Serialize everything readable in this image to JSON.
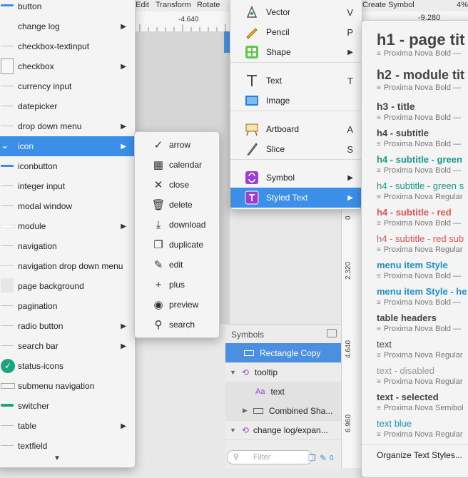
{
  "toolbar": {
    "edit": "Edit",
    "transform": "Transform",
    "rotate": "Rotate",
    "create_symbol": "Create Symbol",
    "zoom": "4%",
    "coord_x": "-4.640",
    "coord_right": "-9.280"
  },
  "ruler": {
    "marks": [
      "0",
      "2.320",
      "4.640",
      "6.960"
    ]
  },
  "menu1": {
    "items": [
      {
        "label": "button",
        "has_sub": false
      },
      {
        "label": "change log",
        "has_sub": true
      },
      {
        "label": "checkbox-textinput",
        "has_sub": false
      },
      {
        "label": "checkbox",
        "has_sub": true
      },
      {
        "label": "currency input",
        "has_sub": false
      },
      {
        "label": "datepicker",
        "has_sub": false
      },
      {
        "label": "drop down menu",
        "has_sub": true
      },
      {
        "label": "icon",
        "has_sub": true,
        "selected": true
      },
      {
        "label": "iconbutton",
        "has_sub": false
      },
      {
        "label": "integer input",
        "has_sub": false
      },
      {
        "label": "modal window",
        "has_sub": false
      },
      {
        "label": "module",
        "has_sub": true
      },
      {
        "label": "navigation",
        "has_sub": false
      },
      {
        "label": "navigation drop down menu",
        "has_sub": false
      },
      {
        "label": "page background",
        "has_sub": false
      },
      {
        "label": "pagination",
        "has_sub": false
      },
      {
        "label": "radio button",
        "has_sub": true
      },
      {
        "label": "search bar",
        "has_sub": true
      },
      {
        "label": "status-icons",
        "has_sub": false
      },
      {
        "label": "submenu navigation",
        "has_sub": false
      },
      {
        "label": "switcher",
        "has_sub": false
      },
      {
        "label": "table",
        "has_sub": true
      },
      {
        "label": "textfield",
        "has_sub": false
      }
    ],
    "scroll_down": "▼"
  },
  "menu2": {
    "items": [
      {
        "label": "arrow",
        "icon": "chevron-down-icon",
        "glyph": "✓"
      },
      {
        "label": "calendar",
        "icon": "calendar-icon",
        "glyph": "▦"
      },
      {
        "label": "close",
        "icon": "close-icon",
        "glyph": "✕"
      },
      {
        "label": "delete",
        "icon": "trash-icon",
        "glyph": "🗑"
      },
      {
        "label": "download",
        "icon": "download-icon",
        "glyph": "⤓"
      },
      {
        "label": "duplicate",
        "icon": "duplicate-icon",
        "glyph": "❐"
      },
      {
        "label": "edit",
        "icon": "edit-icon",
        "glyph": "✎"
      },
      {
        "label": "plus",
        "icon": "plus-icon",
        "glyph": "+"
      },
      {
        "label": "preview",
        "icon": "eye-icon",
        "glyph": "◉"
      },
      {
        "label": "search",
        "icon": "search-icon",
        "glyph": "⚲"
      }
    ]
  },
  "menu3": {
    "items": [
      {
        "label": "Vector",
        "key": "V",
        "icon": "vector-pen-icon"
      },
      {
        "label": "Pencil",
        "key": "P",
        "icon": "pencil-icon"
      },
      {
        "label": "Shape",
        "key": "▶",
        "icon": "shape-icon"
      },
      {
        "label": "Text",
        "key": "T",
        "icon": "text-tool-icon"
      },
      {
        "label": "Image",
        "key": "",
        "icon": "image-icon"
      },
      {
        "label": "Artboard",
        "key": "A",
        "icon": "artboard-icon"
      },
      {
        "label": "Slice",
        "key": "S",
        "icon": "slice-knife-icon"
      },
      {
        "label": "Symbol",
        "key": "▶",
        "icon": "symbol-icon"
      },
      {
        "label": "Styled Text",
        "key": "▶",
        "icon": "styled-text-icon",
        "selected": true
      }
    ]
  },
  "symbols_panel": {
    "title": "Symbols",
    "rows": [
      {
        "label": "Rectangle Copy",
        "selected": true
      },
      {
        "label": "tooltip"
      },
      {
        "label": "text",
        "prefix": "Aa"
      },
      {
        "label": "Combined Sha..."
      },
      {
        "label": "change log/expan..."
      }
    ],
    "filter_placeholder": "Filter",
    "filter_count": "0"
  },
  "styles_menu": {
    "items": [
      {
        "name": "h1 - page tit",
        "meta": "Proxima Nova Bold — ",
        "color": "#444444"
      },
      {
        "name": "h2 - module tit",
        "meta": "Proxima Nova Bold — ",
        "color": "#444444"
      },
      {
        "name": "h3 - title",
        "meta": "Proxima Nova Bold — ",
        "color": "#444444"
      },
      {
        "name": "h4 - subtitle",
        "meta": "Proxima Nova Bold — ",
        "color": "#444444"
      },
      {
        "name": "h4 - subtitle - green",
        "meta": "Proxima Nova Bold — ",
        "color": "#1a9a88"
      },
      {
        "name": "h4 - subtitle - green s",
        "meta": "Proxima Nova Regular",
        "color": "#1a9a88"
      },
      {
        "name": "h4 - subtitle - red",
        "meta": "Proxima Nova Bold — ",
        "color": "#e05555"
      },
      {
        "name": "h4 - subtitle - red sub",
        "meta": "Proxima Nova Regular",
        "color": "#e05555"
      },
      {
        "name": "menu item Style",
        "meta": "Proxima Nova Bold — ",
        "color": "#1e8fc6"
      },
      {
        "name": "menu item Style - he",
        "meta": "Proxima Nova Bold — ",
        "color": "#1e8fc6"
      },
      {
        "name": "table headers",
        "meta": "Proxima Nova Bold — ",
        "color": "#444444"
      },
      {
        "name": "text",
        "meta": "Proxima Nova Regular",
        "color": "#444444"
      },
      {
        "name": "text - disabled",
        "meta": "Proxima Nova Regular",
        "color": "#999999"
      },
      {
        "name": "text - selected",
        "meta": "Proxima Nova Semibol",
        "color": "#444444"
      },
      {
        "name": "text blue",
        "meta": "Proxima Nova Regular",
        "color": "#1e8fc6"
      }
    ],
    "organize": "Organize Text Styles..."
  },
  "colors": {
    "accent": "#3b8fe8",
    "status_green": "#1aa57c",
    "symbol_purple": "#9b3fd3"
  }
}
